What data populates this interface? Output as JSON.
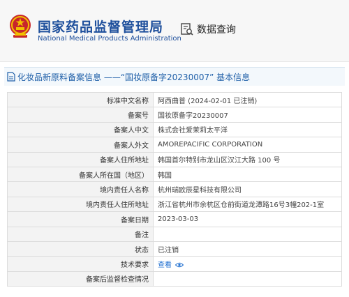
{
  "header": {
    "site_name_cn": "国家药品监督管理局",
    "site_name_en": "National Medical Products Administration",
    "query_label": "数据查询"
  },
  "section": {
    "title": "化妆品新原料备案信息 ——“国妆原备字20230007” 基本信息"
  },
  "details": [
    {
      "label": "标准中文名称",
      "value": "阿西曲普 (2024-02-01 已注销)"
    },
    {
      "label": "备案号",
      "value": "国妆原备字20230007"
    },
    {
      "label": "备案人中文",
      "value": "株式会社爱茉莉太平洋"
    },
    {
      "label": "备案人外文",
      "value": "AMOREPACIFIC CORPORATION"
    },
    {
      "label": "备案人住所地址",
      "value": "韩国首尔特别市龙山区汉江大路 100 号"
    },
    {
      "label": "备案人所在国（地区）",
      "value": "韩国"
    },
    {
      "label": "境内责任人名称",
      "value": "杭州瑞欧辰星科技有限公司"
    },
    {
      "label": "境内责任人住所地址",
      "value": "浙江省杭州市余杭区仓前街道龙潭路16号3幢202-1室"
    },
    {
      "label": "备案日期",
      "value": "2023-03-03"
    },
    {
      "label": "备注",
      "value": ""
    },
    {
      "label": "状态",
      "value": "已注销"
    },
    {
      "label": "技术要求",
      "value": "查看"
    },
    {
      "label": "备案后监督检查情况",
      "value": ""
    }
  ],
  "icons": {
    "emblem": "national-emblem-icon",
    "query": "data-query-icon",
    "section": "document-icon",
    "view": "eye-icon"
  },
  "colors": {
    "brand_blue": "#1e4f9c",
    "link_blue": "#1f6fd0",
    "label_bg": "#f3f3f3"
  }
}
